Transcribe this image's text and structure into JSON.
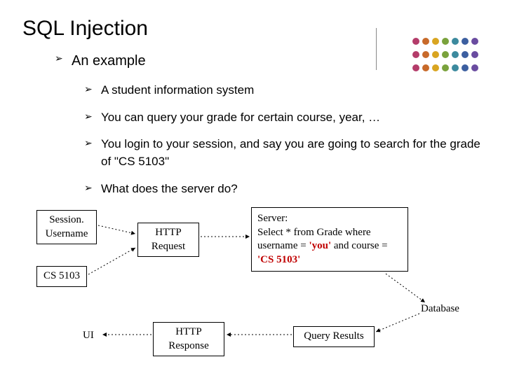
{
  "title": "SQL Injection",
  "h1": "An example",
  "bullets": [
    "A student information system",
    "You can query your grade for certain course, year, …",
    "You login to your session, and say you are going to search for the grade of \"CS 5103\"",
    "What does the server do?"
  ],
  "boxes": {
    "session": "Session.\nUsername",
    "cs5103": "CS 5103",
    "httpReq": "HTTP\nRequest",
    "serverPrefix": "Server:\nSelect * from Grade where username = ",
    "serverYou": "'you'",
    "serverMid": " and course = ",
    "serverCourse": "'CS 5103'",
    "httpResp": "HTTP\nResponse",
    "queryRes": "Query Results"
  },
  "labels": {
    "ui": "UI",
    "database": "Database"
  },
  "dot_colors": [
    "#b43c6a",
    "#c86a2a",
    "#d9a521",
    "#7aa23c",
    "#3c8a9e",
    "#3c5fa0",
    "#6a4ca0"
  ]
}
